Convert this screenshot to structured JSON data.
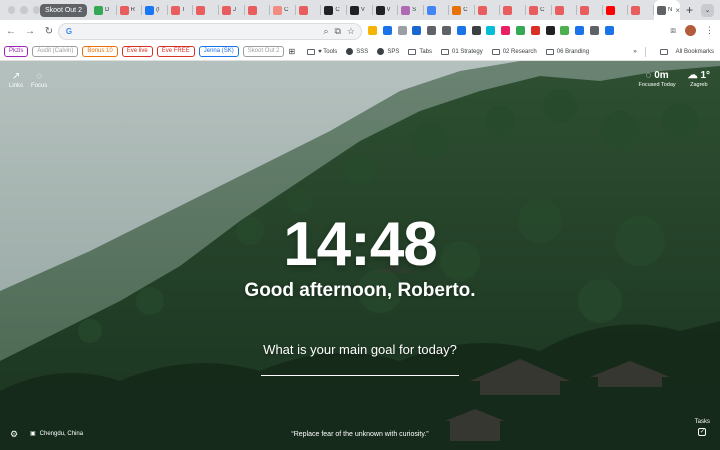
{
  "tabstrip": {
    "group_label": "Skoot Out 2",
    "tabs": [
      {
        "title": "D",
        "color": "#34a853"
      },
      {
        "title": "R",
        "color": "#e85d5d"
      },
      {
        "title": "(l",
        "color": "#1877f2"
      },
      {
        "title": "T",
        "color": "#e85d5d"
      },
      {
        "title": "",
        "color": "#e85d5d"
      },
      {
        "title": "J",
        "color": "#e85d5d"
      },
      {
        "title": "",
        "color": "#e85d5d"
      },
      {
        "title": "C",
        "color": "#f28b82"
      },
      {
        "title": "",
        "color": "#e85d5d"
      },
      {
        "title": "C",
        "color": "#202124"
      },
      {
        "title": "V",
        "color": "#202124"
      },
      {
        "title": "V",
        "color": "#202124"
      },
      {
        "title": "S",
        "color": "#b06ab3"
      },
      {
        "title": "",
        "color": "#4285f4"
      },
      {
        "title": "C",
        "color": "#e8710a"
      },
      {
        "title": "",
        "color": "#e85d5d"
      },
      {
        "title": "",
        "color": "#e85d5d"
      },
      {
        "title": "C",
        "color": "#e85d5d"
      },
      {
        "title": "",
        "color": "#e85d5d"
      },
      {
        "title": "",
        "color": "#e85d5d"
      },
      {
        "title": "",
        "color": "#ff0000"
      },
      {
        "title": "",
        "color": "#e85d5d"
      },
      {
        "title": "N",
        "color": "#5f6368",
        "active": true
      }
    ],
    "new_tab": "+",
    "tab_search": "⌄"
  },
  "toolbar": {
    "back": "←",
    "forward": "→",
    "reload": "↻",
    "omnibox_value": "",
    "omnibox_g": "G",
    "menu": "⋮"
  },
  "bookmarks": {
    "chips": [
      {
        "label": "Pkzls",
        "color": "#9c27b0"
      },
      {
        "label": "Audit (Calvin)",
        "color": "#9e9e9e"
      },
      {
        "label": "Bonus 10",
        "color": "#e8710a"
      },
      {
        "label": "Eve live",
        "color": "#d93025"
      },
      {
        "label": "Eve FREE",
        "color": "#d93025"
      },
      {
        "label": "Jenna (SK)",
        "color": "#1a73e8"
      },
      {
        "label": "Skoot Out 2",
        "color": "#9e9e9e"
      }
    ],
    "items": [
      {
        "label": "♥ Tools",
        "type": "folder"
      },
      {
        "label": "SSS",
        "type": "globe"
      },
      {
        "label": "SPS",
        "type": "globe"
      },
      {
        "label": "Tabs",
        "type": "folder"
      },
      {
        "label": "01 Strategy",
        "type": "folder"
      },
      {
        "label": "02 Research",
        "type": "folder"
      },
      {
        "label": "06 Branding",
        "type": "folder"
      }
    ],
    "more": "»",
    "all_bookmarks": "All Bookmarks"
  },
  "momentum": {
    "top_left": [
      {
        "icon": "↗",
        "label": "Links"
      },
      {
        "icon": "◌",
        "label": "Focus"
      }
    ],
    "focused": {
      "value": "0m",
      "label": "Focused Today"
    },
    "weather": {
      "value": "1°",
      "label": "Zagreb"
    },
    "clock": "14:48",
    "greeting": "Good afternoon, Roberto.",
    "goal_prompt": "What is your main goal for today?",
    "location": "Chengdu, China",
    "quote": "“Replace fear of the unknown with curiosity.”",
    "tasks_label": "Tasks"
  }
}
